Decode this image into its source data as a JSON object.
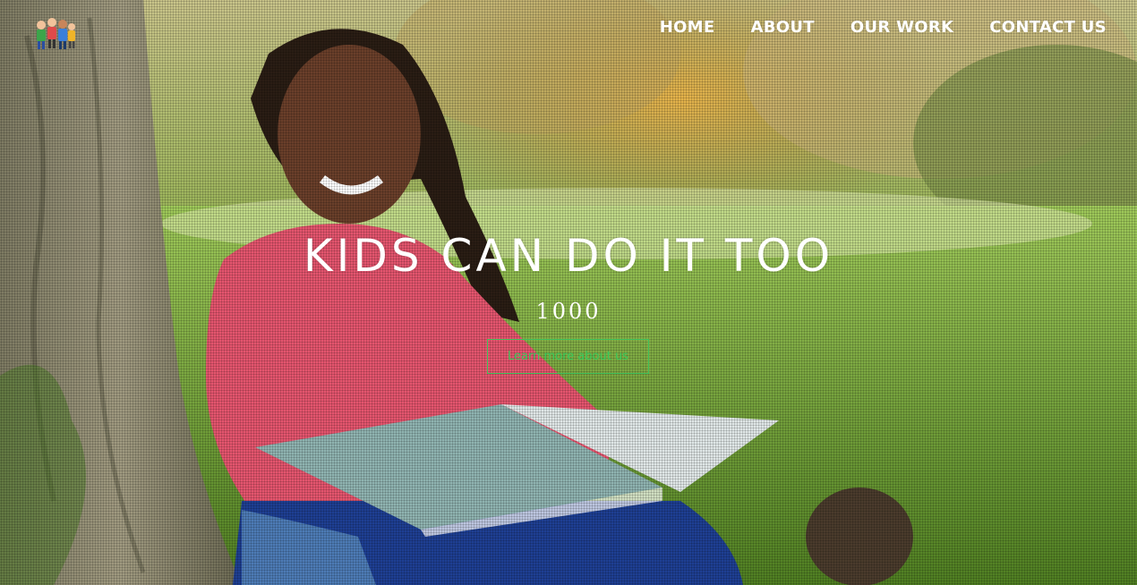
{
  "site": {
    "logo_icon": "kids-group-logo-icon"
  },
  "nav": {
    "items": [
      {
        "label": "HOME"
      },
      {
        "label": "ABOUT"
      },
      {
        "label": "OUR WORK"
      },
      {
        "label": "CONTACT US"
      }
    ]
  },
  "hero": {
    "title": "KIDS CAN DO IT TOO",
    "subtitle": "1000",
    "cta_label": "Learn more about us",
    "background_image": "girl-reading-book-under-tree-photo",
    "colors": {
      "cta_accent": "#37c95a",
      "text": "#ffffff"
    }
  }
}
